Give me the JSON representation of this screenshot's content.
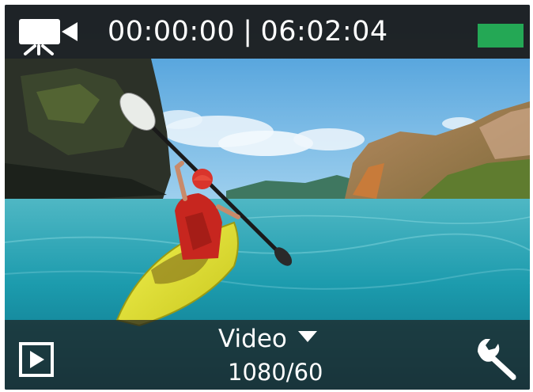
{
  "top_bar": {
    "mode_icon": "video-camera-icon",
    "elapsed_time": "00:00:00",
    "separator": "|",
    "remaining_time": "06:02:04",
    "battery_icon": "battery-icon",
    "battery_color": "#24a855"
  },
  "bottom_bar": {
    "playback_icon": "play-icon",
    "mode_label": "Video",
    "mode_dropdown_icon": "chevron-down-icon",
    "resolution": "1080/60",
    "settings_icon": "wrench-icon"
  },
  "preview": {
    "scene": "kayaker-on-turquoise-water-preview"
  }
}
